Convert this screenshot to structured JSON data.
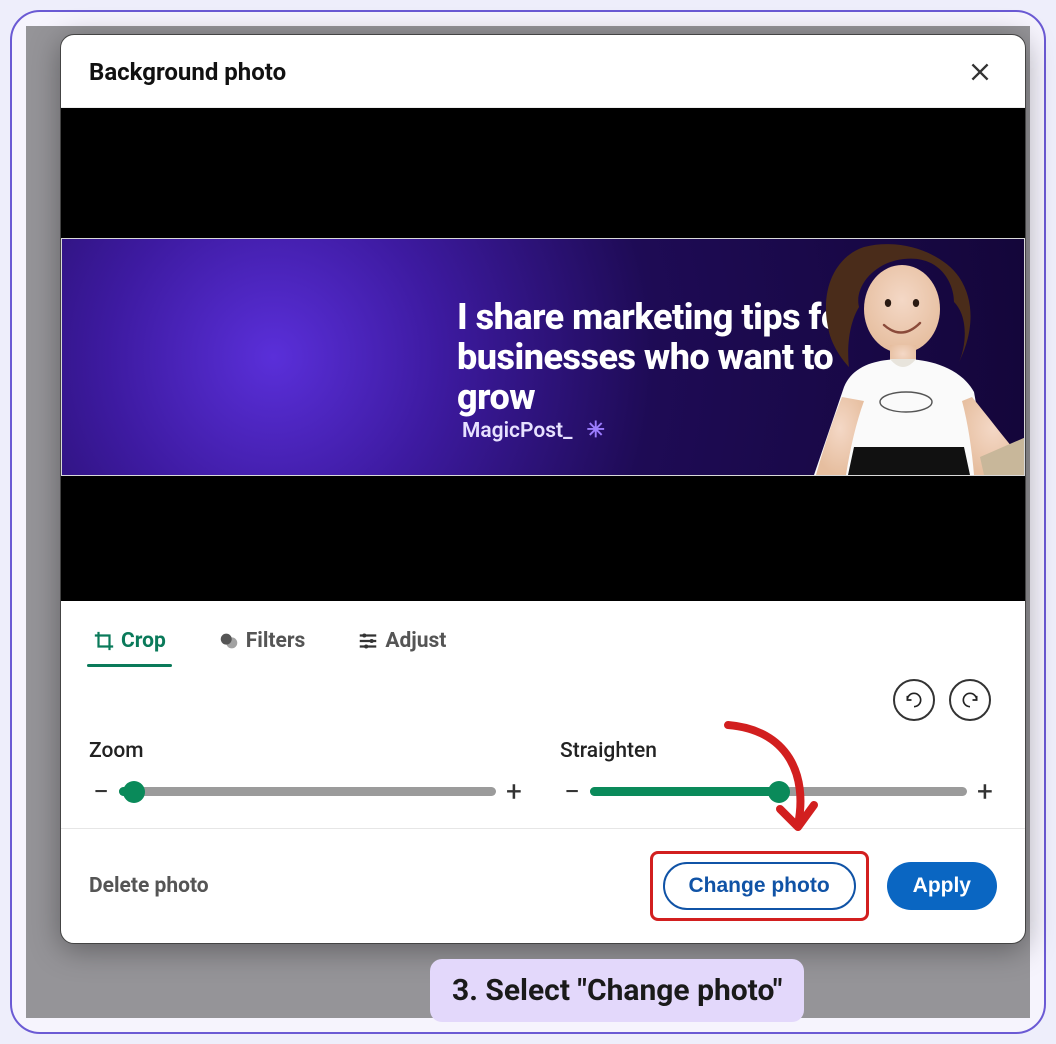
{
  "modal": {
    "title": "Background photo",
    "banner_headline": "I share marketing tips for businesses who want to grow",
    "banner_brand": "MagicPost_"
  },
  "tabs": {
    "crop": "Crop",
    "filters": "Filters",
    "adjust": "Adjust"
  },
  "sliders": {
    "zoom_label": "Zoom",
    "zoom_pct": 4,
    "straighten_label": "Straighten",
    "straighten_pct": 50
  },
  "footer": {
    "delete": "Delete photo",
    "change": "Change photo",
    "apply": "Apply"
  },
  "caption": "3. Select \"Change photo\""
}
